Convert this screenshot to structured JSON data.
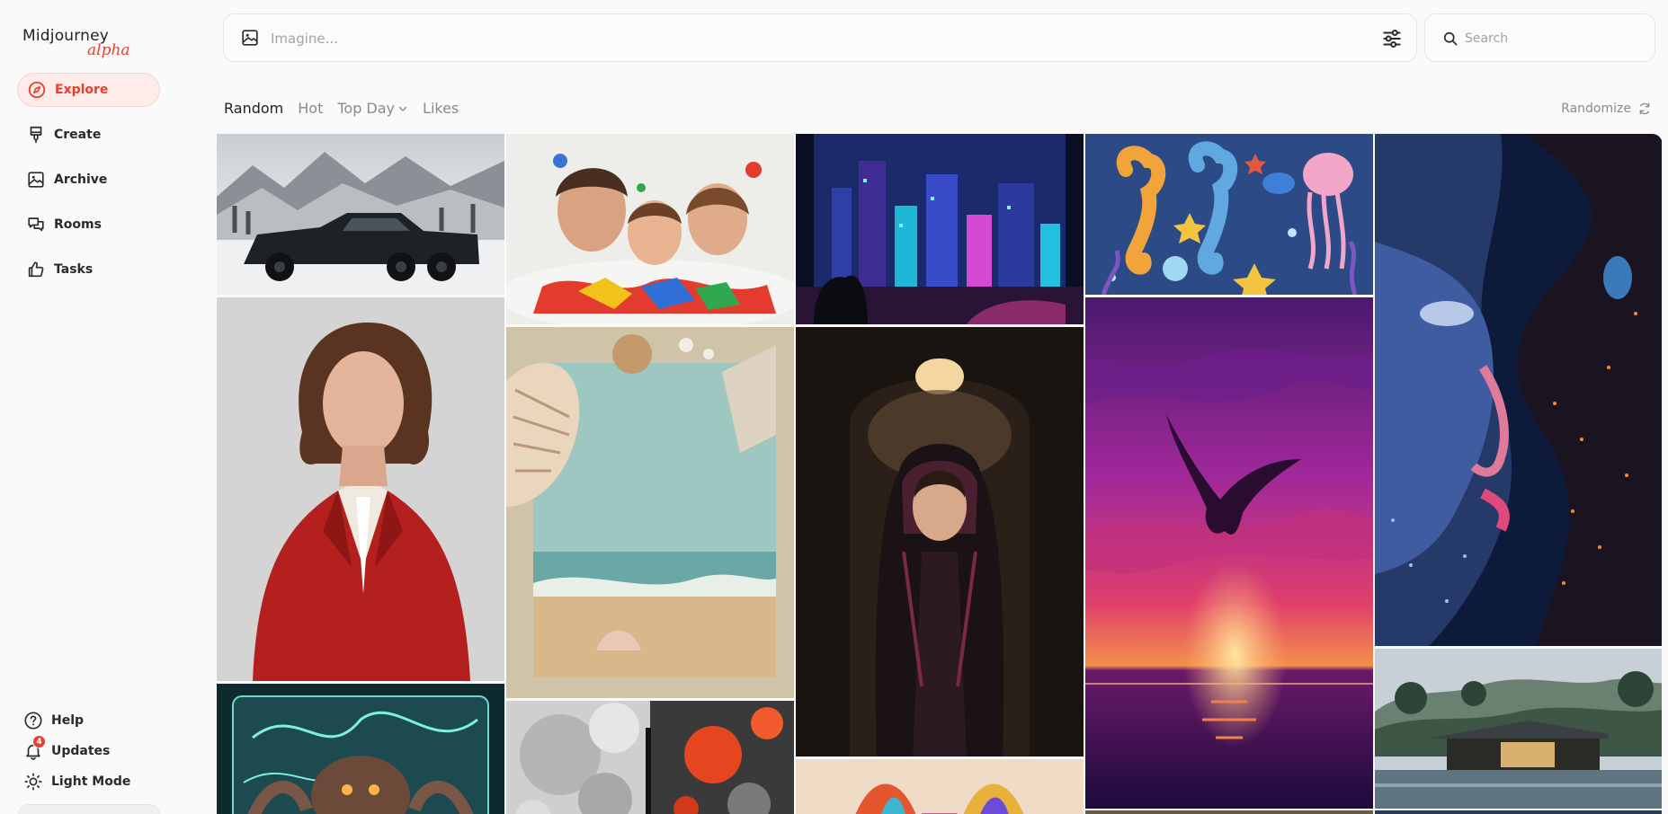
{
  "app": {
    "logo": "Midjourney",
    "logo_tag": "alpha"
  },
  "sidebar": {
    "items": [
      {
        "label": "Explore",
        "icon": "compass-icon",
        "active": true
      },
      {
        "label": "Create",
        "icon": "paintbrush-icon",
        "active": false
      },
      {
        "label": "Archive",
        "icon": "image-icon",
        "active": false
      },
      {
        "label": "Rooms",
        "icon": "chat-bubbles-icon",
        "active": false
      },
      {
        "label": "Tasks",
        "icon": "thumbs-up-icon",
        "active": false
      }
    ],
    "bottom": [
      {
        "label": "Help",
        "icon": "question-circle-icon"
      },
      {
        "label": "Updates",
        "icon": "bell-icon",
        "badge": "4"
      },
      {
        "label": "Light Mode",
        "icon": "sun-icon"
      }
    ]
  },
  "topbar": {
    "imagine_placeholder": "Imagine...",
    "search_placeholder": "Search"
  },
  "tabs": [
    {
      "label": "Random",
      "active": true
    },
    {
      "label": "Hot",
      "active": false
    },
    {
      "label": "Top Day",
      "active": false,
      "dropdown": true
    },
    {
      "label": "Likes",
      "active": false
    }
  ],
  "randomize_label": "Randomize",
  "colors": {
    "accent": "#e8402d",
    "active_bg": "#fdecea"
  },
  "gallery": {
    "images": [
      {
        "subject": "black six-wheel truck in snowy mountains"
      },
      {
        "subject": "family covered in paint"
      },
      {
        "subject": "neon cyberpunk city view from window with cat"
      },
      {
        "subject": "seahorses and jellyfish illustration"
      },
      {
        "subject": "glowing face beside cosmic cat"
      },
      {
        "subject": "woman in red blazer"
      },
      {
        "subject": "seashell beach collage"
      },
      {
        "subject": "hooded woman in dark cloak"
      },
      {
        "subject": "eagle over purple sunset sea"
      },
      {
        "subject": "modern house in misty hills"
      },
      {
        "subject": "octopus creature with green glow"
      },
      {
        "subject": "grey and orange bubbles"
      },
      {
        "subject": "colorful feathered artwork"
      }
    ]
  }
}
